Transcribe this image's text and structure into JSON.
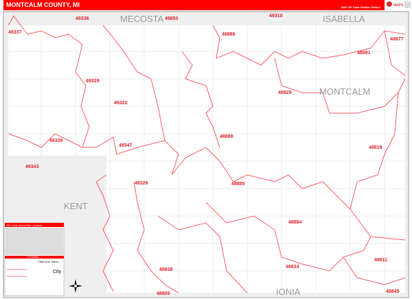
{
  "header": {
    "title": "MONTCALM COUNTY, MI",
    "subtitle": "2020 ZIP Code Redline Edition",
    "logo_text": "MarketMAPS"
  },
  "counties": {
    "mecosta": "MECOSTA",
    "isabella": "ISABELLA",
    "montcalm": "MONTCALM",
    "kent": "KENT",
    "ionia": "IONIA"
  },
  "zips": [
    "49336",
    "48850",
    "49310",
    "49337",
    "48886",
    "48891",
    "48877",
    "49329",
    "48829",
    "49322",
    "49339",
    "49347",
    "48888",
    "48818",
    "49343",
    "49326",
    "48885",
    "48884",
    "48811",
    "48834",
    "48838",
    "48809",
    "48845"
  ],
  "legend": {
    "title": "ZIP Code Index/Grid Location",
    "legend_title": "LEGEND",
    "cities_title": "Cities and Towns",
    "city_sample": "City"
  },
  "colors": {
    "header": "#ff0000",
    "zip_boundary": "#ff5a64",
    "county_bg": "#efefef",
    "map_bg": "#ffffff"
  }
}
